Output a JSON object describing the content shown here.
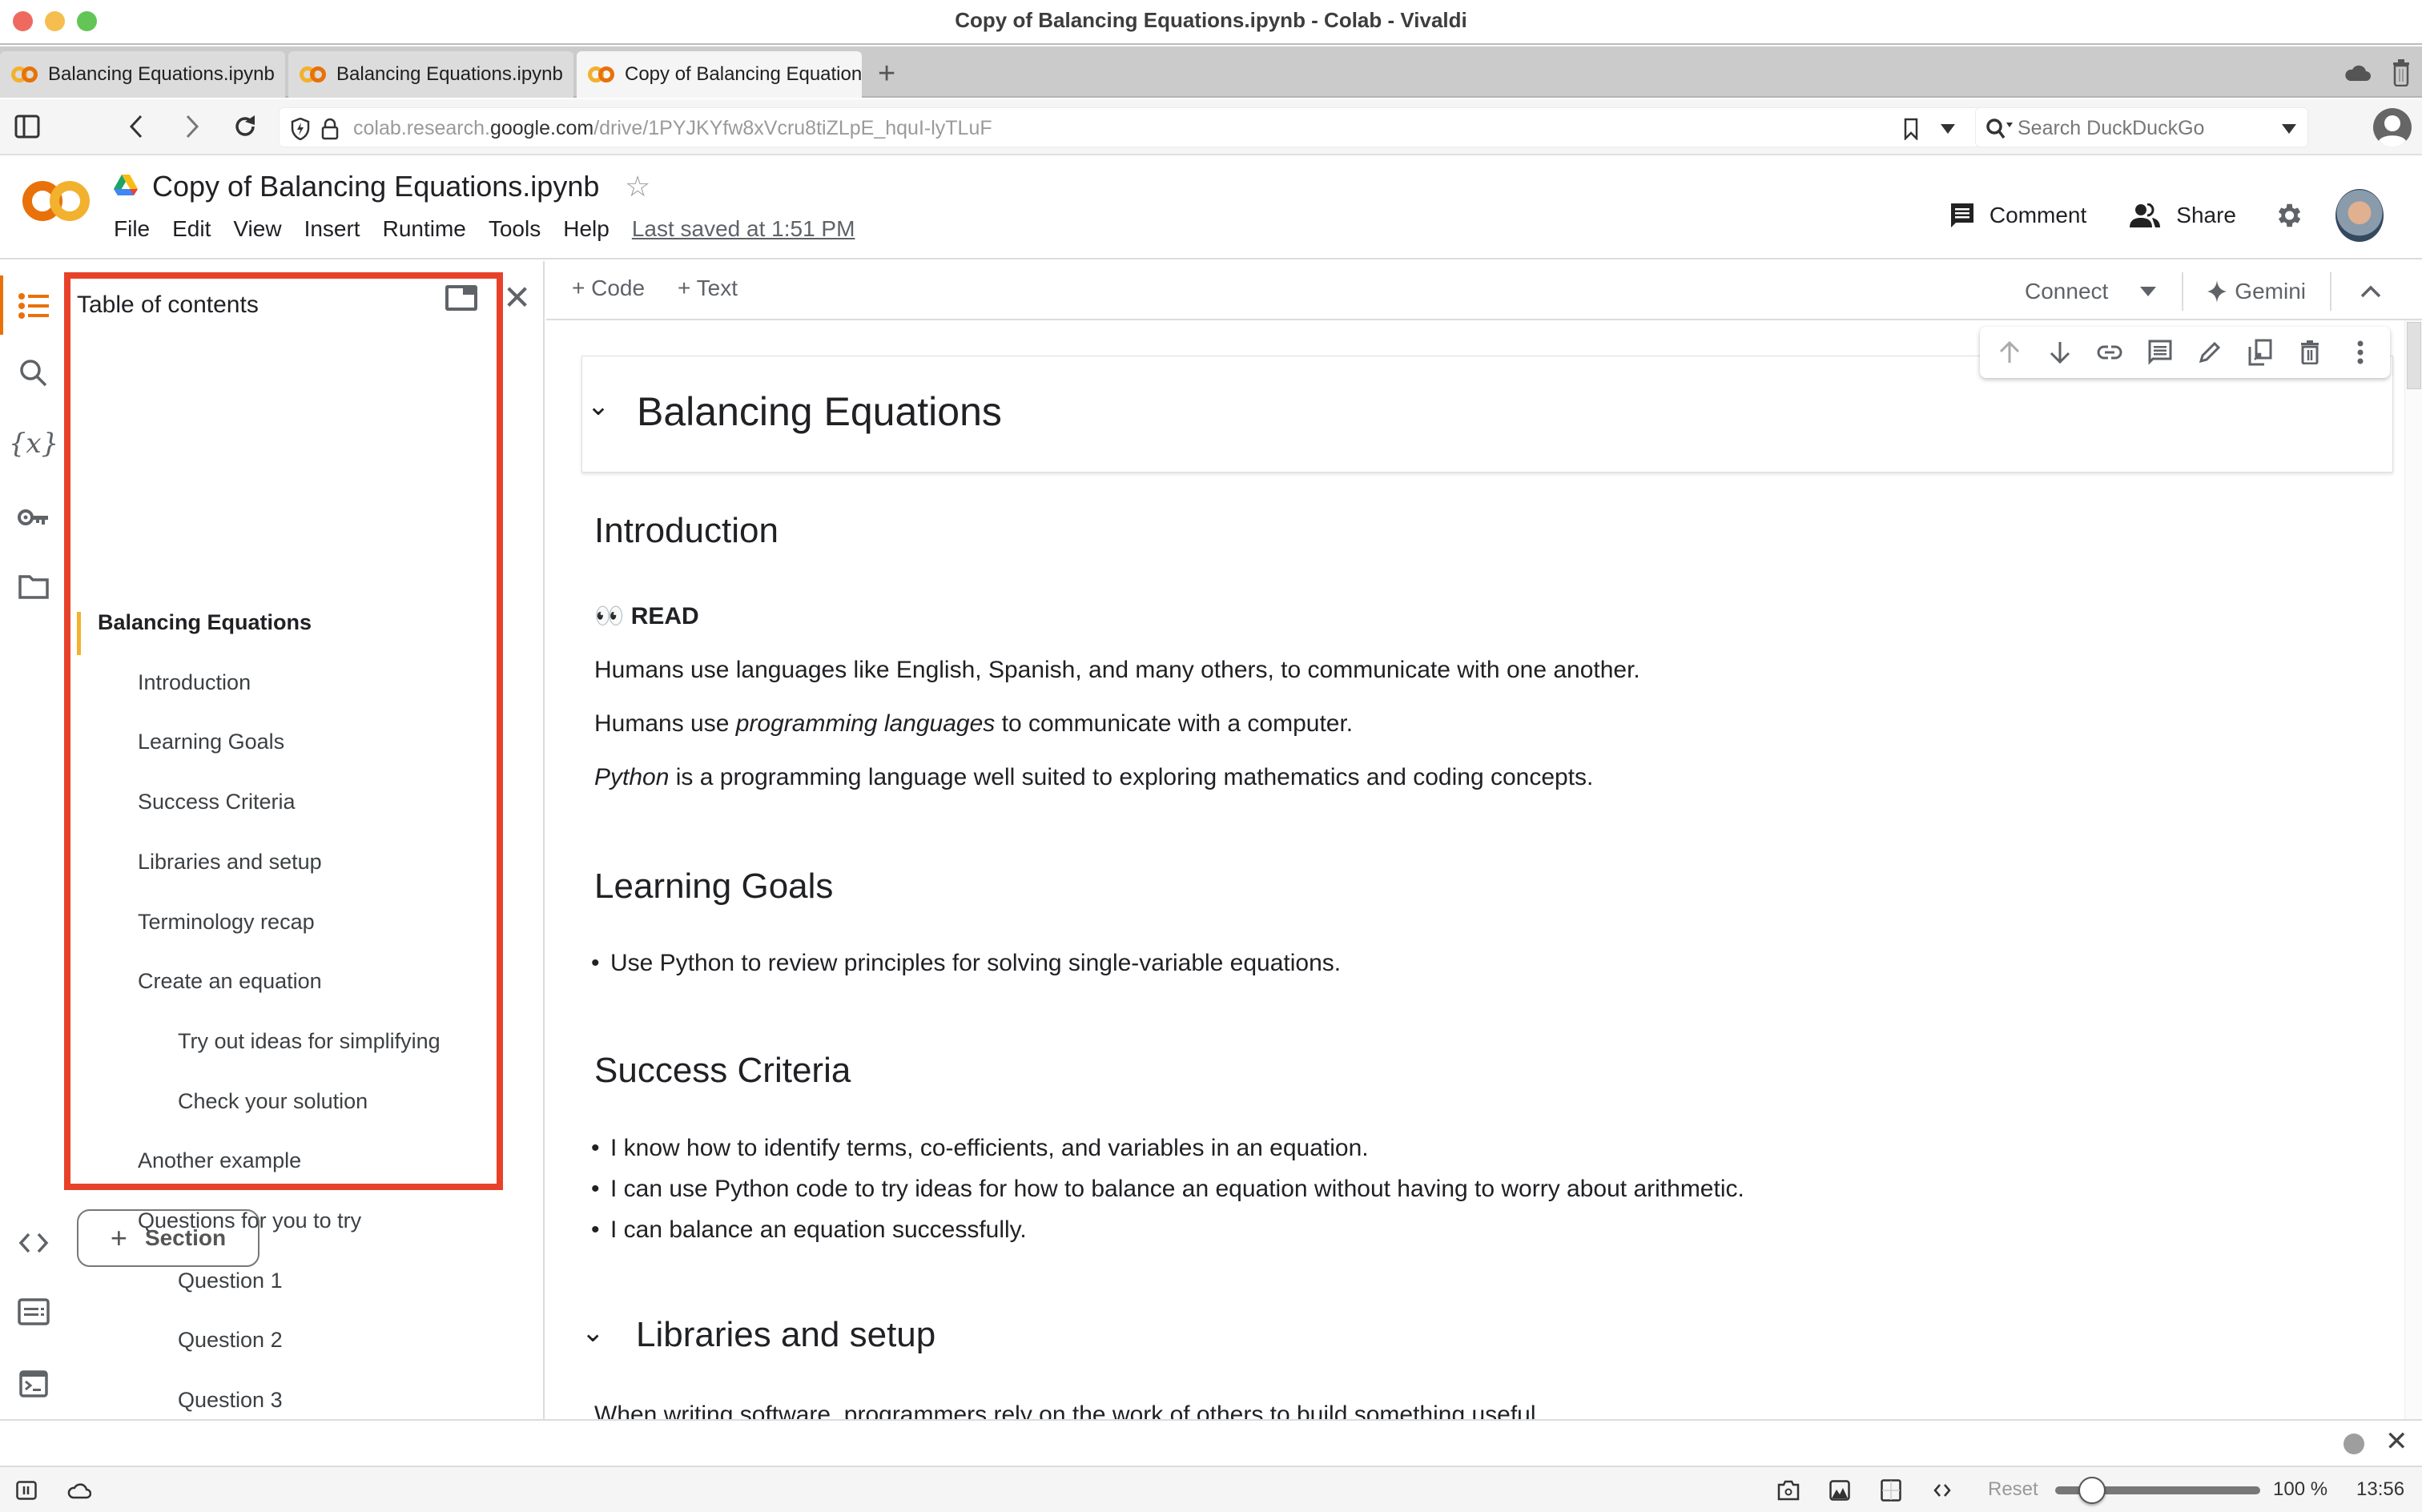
{
  "window": {
    "title": "Copy of Balancing Equations.ipynb - Colab - Vivaldi",
    "traffic_colors": [
      "#ee6a5f",
      "#f5be4f",
      "#62c555"
    ]
  },
  "browser": {
    "tabs": [
      {
        "label": "Balancing Equations.ipynb",
        "active": false
      },
      {
        "label": "Balancing Equations.ipynb",
        "active": false
      },
      {
        "label": "Copy of Balancing Equation",
        "active": true
      }
    ],
    "new_tab_label": "+",
    "url_host_prefix": "colab.research.",
    "url_host_main": "google.com",
    "url_path": "/drive/1PYJKYfw8xVcru8tiZLpE_hquI-lyTLuF",
    "search_placeholder": "Search DuckDuckGo"
  },
  "colab": {
    "doc_title": "Copy of Balancing Equations.ipynb",
    "menu": [
      "File",
      "Edit",
      "View",
      "Insert",
      "Runtime",
      "Tools",
      "Help"
    ],
    "last_saved": "Last saved at 1:51 PM",
    "comment_label": "Comment",
    "share_label": "Share",
    "brand_colors": {
      "orange": "#e8710a",
      "yellow": "#f2b12e"
    }
  },
  "toc": {
    "title": "Table of contents",
    "items": [
      {
        "label": "Balancing Equations",
        "level": 1,
        "active": true
      },
      {
        "label": "Introduction",
        "level": 2
      },
      {
        "label": "Learning Goals",
        "level": 2
      },
      {
        "label": "Success Criteria",
        "level": 2
      },
      {
        "label": "Libraries and setup",
        "level": 2
      },
      {
        "label": "Terminology recap",
        "level": 2
      },
      {
        "label": "Create an equation",
        "level": 2
      },
      {
        "label": "Try out ideas for simplifying",
        "level": 3
      },
      {
        "label": "Check your solution",
        "level": 3
      },
      {
        "label": "Another example",
        "level": 2
      },
      {
        "label": "Questions for you to try",
        "level": 2
      },
      {
        "label": "Question 1",
        "level": 3
      },
      {
        "label": "Question 2",
        "level": 3
      },
      {
        "label": "Question 3",
        "level": 3
      }
    ],
    "section_button": "Section",
    "highlight_color": "#e8412a"
  },
  "notebook": {
    "toolbar": {
      "code_label": "Code",
      "text_label": "Text",
      "connect_label": "Connect",
      "gemini_label": "Gemini"
    },
    "title_cell": "Balancing Equations",
    "introduction": {
      "heading": "Introduction",
      "read_emoji": "👀",
      "read_label": "READ",
      "p1": "Humans use languages like English, Spanish, and many others, to communicate with one another.",
      "p2_start": "Humans use ",
      "p2_em": "programming languages",
      "p2_end": " to communicate with a computer.",
      "p3_em": "Python",
      "p3_end": " is a programming language well suited to exploring mathematics and coding concepts."
    },
    "learning_goals": {
      "heading": "Learning Goals",
      "bullets": [
        "Use Python to review principles for solving single-variable equations."
      ]
    },
    "success_criteria": {
      "heading": "Success Criteria",
      "bullets": [
        "I know how to identify terms, co-efficients, and variables in an equation.",
        "I can use Python code to try ideas for how to balance an equation without having to worry about arithmetic.",
        "I can balance an equation successfully."
      ]
    },
    "libraries": {
      "heading": "Libraries and setup",
      "p1": "When writing software, programmers rely on the work of others to build something useful."
    }
  },
  "statusbar": {
    "reset_label": "Reset",
    "zoom_level": "100 %",
    "zoom_fraction": 0.18,
    "clock": "13:56"
  }
}
